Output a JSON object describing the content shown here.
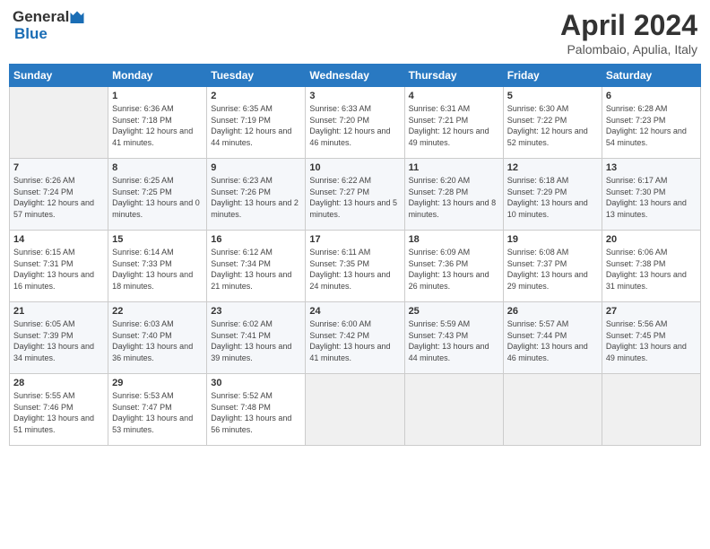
{
  "header": {
    "logo_line1": "General",
    "logo_line2": "Blue",
    "month_title": "April 2024",
    "location": "Palombaio, Apulia, Italy"
  },
  "days_of_week": [
    "Sunday",
    "Monday",
    "Tuesday",
    "Wednesday",
    "Thursday",
    "Friday",
    "Saturday"
  ],
  "weeks": [
    [
      {
        "day": "",
        "sunrise": "",
        "sunset": "",
        "daylight": ""
      },
      {
        "day": "1",
        "sunrise": "Sunrise: 6:36 AM",
        "sunset": "Sunset: 7:18 PM",
        "daylight": "Daylight: 12 hours and 41 minutes."
      },
      {
        "day": "2",
        "sunrise": "Sunrise: 6:35 AM",
        "sunset": "Sunset: 7:19 PM",
        "daylight": "Daylight: 12 hours and 44 minutes."
      },
      {
        "day": "3",
        "sunrise": "Sunrise: 6:33 AM",
        "sunset": "Sunset: 7:20 PM",
        "daylight": "Daylight: 12 hours and 46 minutes."
      },
      {
        "day": "4",
        "sunrise": "Sunrise: 6:31 AM",
        "sunset": "Sunset: 7:21 PM",
        "daylight": "Daylight: 12 hours and 49 minutes."
      },
      {
        "day": "5",
        "sunrise": "Sunrise: 6:30 AM",
        "sunset": "Sunset: 7:22 PM",
        "daylight": "Daylight: 12 hours and 52 minutes."
      },
      {
        "day": "6",
        "sunrise": "Sunrise: 6:28 AM",
        "sunset": "Sunset: 7:23 PM",
        "daylight": "Daylight: 12 hours and 54 minutes."
      }
    ],
    [
      {
        "day": "7",
        "sunrise": "Sunrise: 6:26 AM",
        "sunset": "Sunset: 7:24 PM",
        "daylight": "Daylight: 12 hours and 57 minutes."
      },
      {
        "day": "8",
        "sunrise": "Sunrise: 6:25 AM",
        "sunset": "Sunset: 7:25 PM",
        "daylight": "Daylight: 13 hours and 0 minutes."
      },
      {
        "day": "9",
        "sunrise": "Sunrise: 6:23 AM",
        "sunset": "Sunset: 7:26 PM",
        "daylight": "Daylight: 13 hours and 2 minutes."
      },
      {
        "day": "10",
        "sunrise": "Sunrise: 6:22 AM",
        "sunset": "Sunset: 7:27 PM",
        "daylight": "Daylight: 13 hours and 5 minutes."
      },
      {
        "day": "11",
        "sunrise": "Sunrise: 6:20 AM",
        "sunset": "Sunset: 7:28 PM",
        "daylight": "Daylight: 13 hours and 8 minutes."
      },
      {
        "day": "12",
        "sunrise": "Sunrise: 6:18 AM",
        "sunset": "Sunset: 7:29 PM",
        "daylight": "Daylight: 13 hours and 10 minutes."
      },
      {
        "day": "13",
        "sunrise": "Sunrise: 6:17 AM",
        "sunset": "Sunset: 7:30 PM",
        "daylight": "Daylight: 13 hours and 13 minutes."
      }
    ],
    [
      {
        "day": "14",
        "sunrise": "Sunrise: 6:15 AM",
        "sunset": "Sunset: 7:31 PM",
        "daylight": "Daylight: 13 hours and 16 minutes."
      },
      {
        "day": "15",
        "sunrise": "Sunrise: 6:14 AM",
        "sunset": "Sunset: 7:33 PM",
        "daylight": "Daylight: 13 hours and 18 minutes."
      },
      {
        "day": "16",
        "sunrise": "Sunrise: 6:12 AM",
        "sunset": "Sunset: 7:34 PM",
        "daylight": "Daylight: 13 hours and 21 minutes."
      },
      {
        "day": "17",
        "sunrise": "Sunrise: 6:11 AM",
        "sunset": "Sunset: 7:35 PM",
        "daylight": "Daylight: 13 hours and 24 minutes."
      },
      {
        "day": "18",
        "sunrise": "Sunrise: 6:09 AM",
        "sunset": "Sunset: 7:36 PM",
        "daylight": "Daylight: 13 hours and 26 minutes."
      },
      {
        "day": "19",
        "sunrise": "Sunrise: 6:08 AM",
        "sunset": "Sunset: 7:37 PM",
        "daylight": "Daylight: 13 hours and 29 minutes."
      },
      {
        "day": "20",
        "sunrise": "Sunrise: 6:06 AM",
        "sunset": "Sunset: 7:38 PM",
        "daylight": "Daylight: 13 hours and 31 minutes."
      }
    ],
    [
      {
        "day": "21",
        "sunrise": "Sunrise: 6:05 AM",
        "sunset": "Sunset: 7:39 PM",
        "daylight": "Daylight: 13 hours and 34 minutes."
      },
      {
        "day": "22",
        "sunrise": "Sunrise: 6:03 AM",
        "sunset": "Sunset: 7:40 PM",
        "daylight": "Daylight: 13 hours and 36 minutes."
      },
      {
        "day": "23",
        "sunrise": "Sunrise: 6:02 AM",
        "sunset": "Sunset: 7:41 PM",
        "daylight": "Daylight: 13 hours and 39 minutes."
      },
      {
        "day": "24",
        "sunrise": "Sunrise: 6:00 AM",
        "sunset": "Sunset: 7:42 PM",
        "daylight": "Daylight: 13 hours and 41 minutes."
      },
      {
        "day": "25",
        "sunrise": "Sunrise: 5:59 AM",
        "sunset": "Sunset: 7:43 PM",
        "daylight": "Daylight: 13 hours and 44 minutes."
      },
      {
        "day": "26",
        "sunrise": "Sunrise: 5:57 AM",
        "sunset": "Sunset: 7:44 PM",
        "daylight": "Daylight: 13 hours and 46 minutes."
      },
      {
        "day": "27",
        "sunrise": "Sunrise: 5:56 AM",
        "sunset": "Sunset: 7:45 PM",
        "daylight": "Daylight: 13 hours and 49 minutes."
      }
    ],
    [
      {
        "day": "28",
        "sunrise": "Sunrise: 5:55 AM",
        "sunset": "Sunset: 7:46 PM",
        "daylight": "Daylight: 13 hours and 51 minutes."
      },
      {
        "day": "29",
        "sunrise": "Sunrise: 5:53 AM",
        "sunset": "Sunset: 7:47 PM",
        "daylight": "Daylight: 13 hours and 53 minutes."
      },
      {
        "day": "30",
        "sunrise": "Sunrise: 5:52 AM",
        "sunset": "Sunset: 7:48 PM",
        "daylight": "Daylight: 13 hours and 56 minutes."
      },
      {
        "day": "",
        "sunrise": "",
        "sunset": "",
        "daylight": ""
      },
      {
        "day": "",
        "sunrise": "",
        "sunset": "",
        "daylight": ""
      },
      {
        "day": "",
        "sunrise": "",
        "sunset": "",
        "daylight": ""
      },
      {
        "day": "",
        "sunrise": "",
        "sunset": "",
        "daylight": ""
      }
    ]
  ]
}
